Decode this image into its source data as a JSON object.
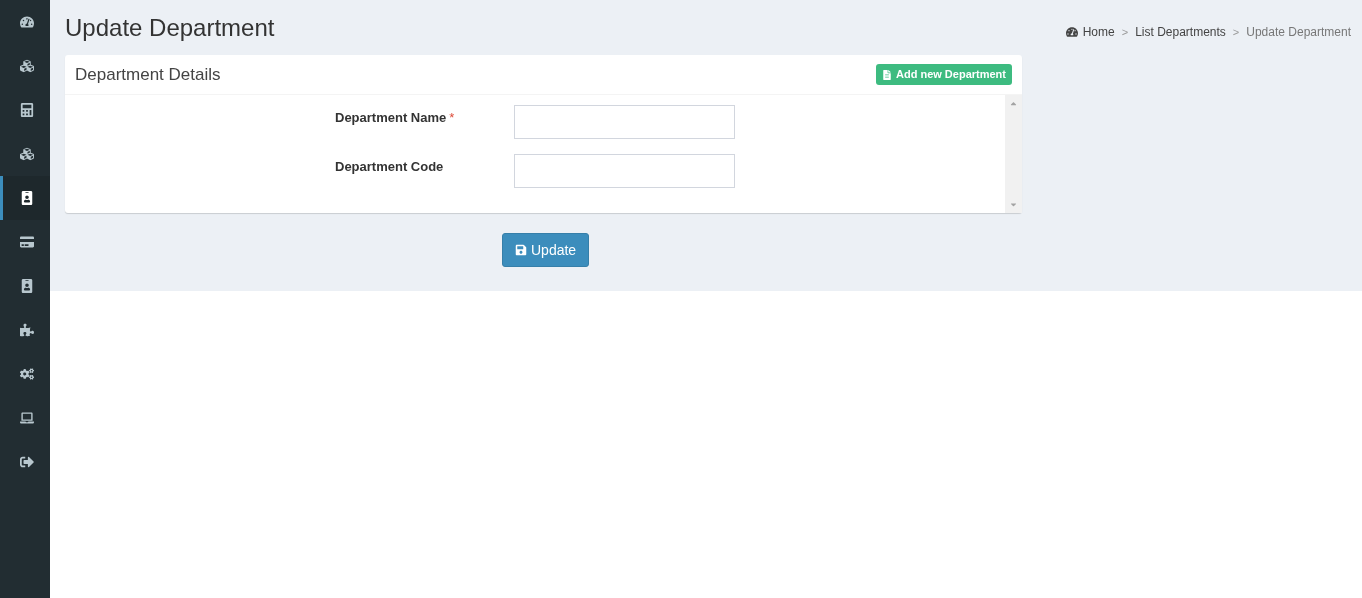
{
  "sidebar": {
    "items": [
      {
        "kind": "dashboard",
        "selected": false
      },
      {
        "kind": "cubes",
        "selected": false
      },
      {
        "kind": "calculator",
        "selected": false
      },
      {
        "kind": "cubes",
        "selected": false
      },
      {
        "kind": "badge",
        "selected": true
      },
      {
        "kind": "card",
        "selected": false
      },
      {
        "kind": "badge",
        "selected": false
      },
      {
        "kind": "puzzle",
        "selected": false
      },
      {
        "kind": "cogs",
        "selected": false
      },
      {
        "kind": "laptop",
        "selected": false
      },
      {
        "kind": "signout",
        "selected": false
      }
    ]
  },
  "page_title": "Update Department",
  "breadcrumb": [
    {
      "kind": "home",
      "label": "Home"
    },
    {
      "kind": "separator",
      "label": ">"
    },
    {
      "kind": "link",
      "label": "List Departments"
    },
    {
      "kind": "separator",
      "label": ">"
    },
    {
      "kind": "current",
      "label": "Update Department"
    }
  ],
  "card": {
    "title": "Department Details",
    "add_button": "Add new Department",
    "fields": [
      {
        "label": "Department Name",
        "required_mark": "*"
      },
      {
        "label": "Department Code"
      }
    ]
  },
  "submit_button": "Update"
}
